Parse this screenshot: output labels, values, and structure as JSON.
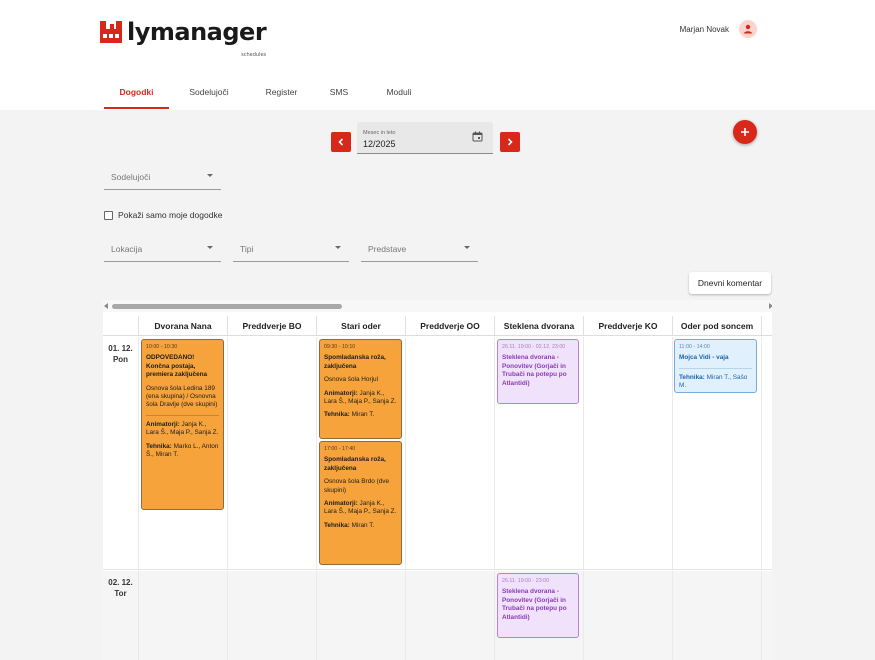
{
  "app": {
    "logo_text": "lymanager",
    "logo_sub": "schedules",
    "brand_color": "#d7281a",
    "user_name": "Marjan Novak"
  },
  "tabs": [
    {
      "label": "Dogodki",
      "active": true
    },
    {
      "label": "Sodelujoči",
      "active": false
    },
    {
      "label": "Register",
      "active": false
    },
    {
      "label": "SMS",
      "active": false
    },
    {
      "label": "Moduli",
      "active": false
    }
  ],
  "toolbar": {
    "month_label": "Mesec in leto",
    "month_value": "12/2025",
    "prev_icon": "chevron-left-icon",
    "next_icon": "chevron-right-icon",
    "add_icon": "plus-icon"
  },
  "filters": {
    "participants_placeholder": "Sodelujoči",
    "only_mine_label": "Pokaži samo moje dogodke",
    "only_mine_checked": false,
    "location_placeholder": "Lokacija",
    "types_placeholder": "Tipi",
    "shows_placeholder": "Predstave",
    "daily_comment_label": "Dnevni komentar"
  },
  "calendar": {
    "columns": [
      "Dvorana Nana",
      "Preddverje BO",
      "Stari oder",
      "Preddverje OO",
      "Steklena dvorana",
      "Preddverje KO",
      "Oder pod soncem"
    ],
    "days": [
      {
        "date": "01. 12.",
        "weekday": "Pon"
      },
      {
        "date": "02. 12.",
        "weekday": "Tor"
      }
    ],
    "events": {
      "e1": {
        "time": "10:00 - 10:30",
        "title": "ODPOVEDANO! Končna postaja, premiera zaključena",
        "desc": "Osnova šola Ledina 189 (ena skupina) / Osnovna šola Dravlje (dve skupini)",
        "animators_label": "Animatorji:",
        "animators": "Janja K., Lara Š., Maja P., Sanja Z.",
        "tech_label": "Tehnika:",
        "tech": "Marko L., Anton Š., Miran T."
      },
      "e2": {
        "time": "09:30 - 10:10",
        "title": "Spomladanska roža, zaključena",
        "desc": "Osnova šola Horjul",
        "animators_label": "Animatorji:",
        "animators": "Janja K., Lara Š., Maja P., Sanja Z.",
        "tech_label": "Tehnika:",
        "tech": "Miran T."
      },
      "e3": {
        "time": "17:00 - 17:40",
        "title": "Spomladanska roža, zaključena",
        "desc": "Osnova šola Brdo (dve skupini)",
        "animators_label": "Animatorji:",
        "animators": "Janja K., Lara Š., Maja P., Sanja Z.",
        "tech_label": "Tehnika:",
        "tech": "Miran T."
      },
      "e4": {
        "time": "26.11. 19:00 - 02.12. 23:00",
        "title": "Steklena dvorana - Ponovitev (Gorjači in Trubači na potepu po Atlantidi)"
      },
      "e5": {
        "time": "11:00 - 14:00",
        "title": "Mojca Vidi - vaja",
        "tech_label": "Tehnika:",
        "tech": "Miran T., Sašo M."
      },
      "e6": {
        "time": "26.11. 19:00 - 23:00",
        "title": "Steklena dvorana - Ponovitev (Gorjači in Trubači na potepu po Atlantidi)"
      }
    }
  }
}
